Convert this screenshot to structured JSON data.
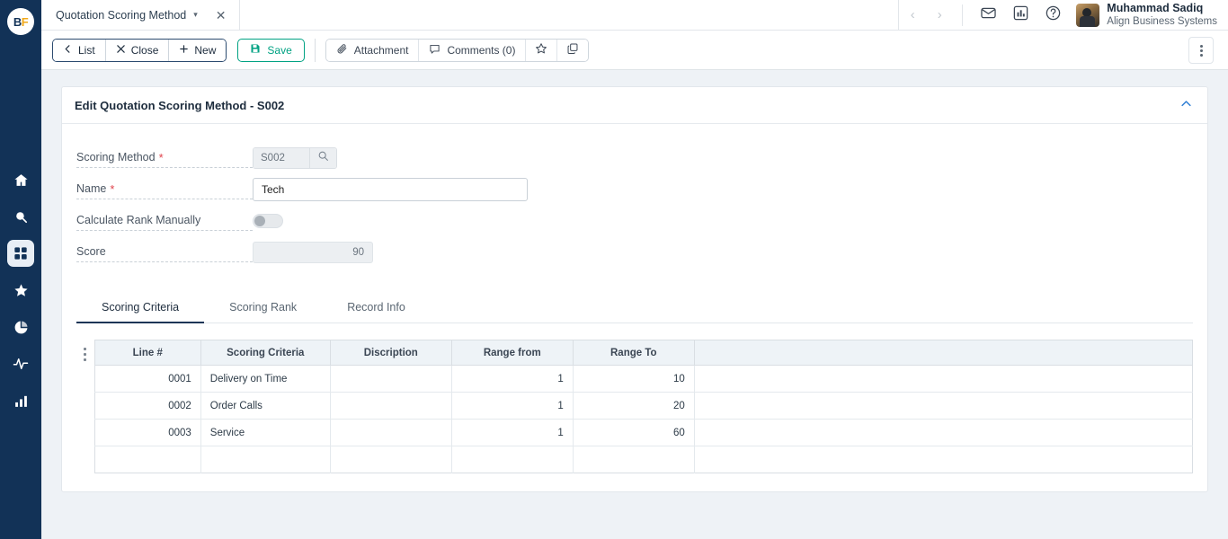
{
  "brand": {
    "logo_b": "B",
    "logo_f": "F"
  },
  "rail": {
    "items": [
      {
        "icon": "home-icon",
        "active": false
      },
      {
        "icon": "search-icon",
        "active": false
      },
      {
        "icon": "apps-grid-icon",
        "active": true
      },
      {
        "icon": "star-icon",
        "active": false
      },
      {
        "icon": "pie-chart-icon",
        "active": false
      },
      {
        "icon": "activity-pulse-icon",
        "active": false
      },
      {
        "icon": "bar-chart-icon",
        "active": false
      }
    ]
  },
  "tabstrip": {
    "doc_tab_label": "Quotation Scoring Method",
    "caret": "▾",
    "close": "✕",
    "prev_arrow": "‹",
    "next_arrow": "›"
  },
  "header": {
    "icons": [
      "mail-icon",
      "report-chart-icon",
      "help-icon"
    ],
    "user_name": "Muhammad Sadiq",
    "user_company": "Align Business Systems"
  },
  "toolbar": {
    "list_label": "List",
    "close_label": "Close",
    "new_label": "New",
    "save_label": "Save",
    "attachment_label": "Attachment",
    "comments_label": "Comments (0)",
    "favorite_icon": "star-outline-icon",
    "duplicate_icon": "copy-icon",
    "kebab_icon": "more-vertical-icon"
  },
  "card": {
    "title": "Edit Quotation Scoring Method - S002",
    "collapse_icon": "chevron-up-icon",
    "collapse_color": "#2f7fd4"
  },
  "form": {
    "scoring_method": {
      "label": "Scoring Method",
      "required": "*",
      "value": "S002",
      "lookup_icon": "search-icon"
    },
    "name": {
      "label": "Name",
      "required": "*",
      "value": "Tech",
      "placeholder": ""
    },
    "calculate_rank_manually": {
      "label": "Calculate Rank Manually",
      "value": "off"
    },
    "score": {
      "label": "Score",
      "value": "90"
    }
  },
  "tabs": [
    {
      "label": "Scoring Criteria",
      "active": true
    },
    {
      "label": "Scoring Rank",
      "active": false
    },
    {
      "label": "Record Info",
      "active": false
    }
  ],
  "grid": {
    "handle_icon": "grid-options-icon",
    "columns": [
      "Line #",
      "Scoring Criteria",
      "Discription",
      "Range from",
      "Range To",
      ""
    ],
    "rows": [
      {
        "line": "0001",
        "criteria": "Delivery on Time",
        "discription": "",
        "range_from": "1",
        "range_to": "10"
      },
      {
        "line": "0002",
        "criteria": "Order Calls",
        "discription": "",
        "range_from": "1",
        "range_to": "20"
      },
      {
        "line": "0003",
        "criteria": "Service",
        "discription": "",
        "range_from": "1",
        "range_to": "60"
      },
      {
        "line": "",
        "criteria": "",
        "discription": "",
        "range_from": "",
        "range_to": ""
      }
    ]
  },
  "colors": {
    "rail_bg": "#123257",
    "accent_save": "#00a283",
    "page_bg": "#eef2f6",
    "tab_active": "#1d3557",
    "required": "#e0434c"
  }
}
